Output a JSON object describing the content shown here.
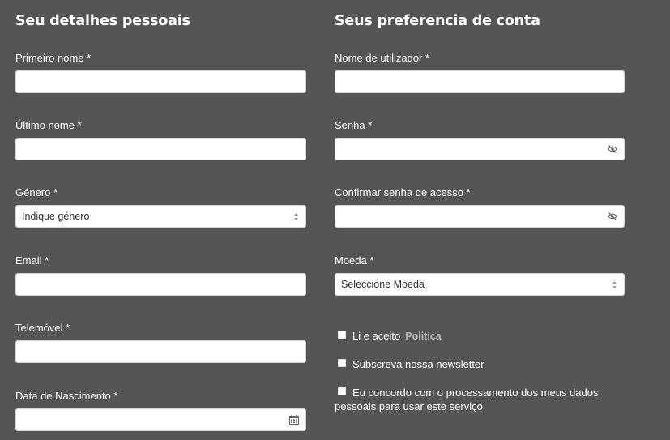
{
  "personal": {
    "heading": "Seu detalhes pessoais",
    "first_name": {
      "label": "Primeiro nome *",
      "value": ""
    },
    "last_name": {
      "label": "Último nome *",
      "value": ""
    },
    "gender": {
      "label": "Género *",
      "selected": "Indique género"
    },
    "email": {
      "label": "Email *",
      "value": ""
    },
    "mobile": {
      "label": "Telemóvel *",
      "value": ""
    },
    "birthdate": {
      "label": "Data de Nascimento *",
      "value": ""
    }
  },
  "account": {
    "heading": "Seus preferencia de conta",
    "username": {
      "label": "Nome de utilizador *",
      "value": ""
    },
    "password": {
      "label": "Senha *",
      "value": ""
    },
    "confirm_password": {
      "label": "Confirmar senha de acesso *",
      "value": ""
    },
    "currency": {
      "label": "Moeda *",
      "selected": "Seleccione Moeda"
    },
    "checkboxes": {
      "policy": {
        "text": "Li e aceito",
        "link": "Politica",
        "checked": false
      },
      "newsletter": {
        "text": "Subscreva nossa newsletter",
        "checked": false
      },
      "consent": {
        "line1": "Eu concordo com o processamento dos meus dados",
        "line2": "pessoais para usar este serviço",
        "checked": false
      }
    }
  },
  "icons": {
    "select_arrows": "up-down-arrows-icon",
    "password_toggle": "eye-slash-icon",
    "date_picker": "calendar-icon"
  },
  "colors": {
    "background": "#555555",
    "input_background": "#ffffff",
    "link": "#b9b9b9"
  }
}
